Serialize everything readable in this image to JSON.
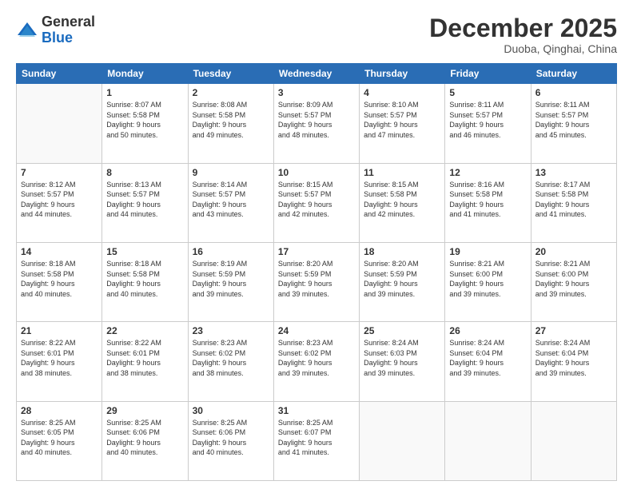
{
  "header": {
    "logo_general": "General",
    "logo_blue": "Blue",
    "month": "December 2025",
    "location": "Duoba, Qinghai, China"
  },
  "weekdays": [
    "Sunday",
    "Monday",
    "Tuesday",
    "Wednesday",
    "Thursday",
    "Friday",
    "Saturday"
  ],
  "weeks": [
    [
      {
        "day": "",
        "info": ""
      },
      {
        "day": "1",
        "info": "Sunrise: 8:07 AM\nSunset: 5:58 PM\nDaylight: 9 hours\nand 50 minutes."
      },
      {
        "day": "2",
        "info": "Sunrise: 8:08 AM\nSunset: 5:58 PM\nDaylight: 9 hours\nand 49 minutes."
      },
      {
        "day": "3",
        "info": "Sunrise: 8:09 AM\nSunset: 5:57 PM\nDaylight: 9 hours\nand 48 minutes."
      },
      {
        "day": "4",
        "info": "Sunrise: 8:10 AM\nSunset: 5:57 PM\nDaylight: 9 hours\nand 47 minutes."
      },
      {
        "day": "5",
        "info": "Sunrise: 8:11 AM\nSunset: 5:57 PM\nDaylight: 9 hours\nand 46 minutes."
      },
      {
        "day": "6",
        "info": "Sunrise: 8:11 AM\nSunset: 5:57 PM\nDaylight: 9 hours\nand 45 minutes."
      }
    ],
    [
      {
        "day": "7",
        "info": "Sunrise: 8:12 AM\nSunset: 5:57 PM\nDaylight: 9 hours\nand 44 minutes."
      },
      {
        "day": "8",
        "info": "Sunrise: 8:13 AM\nSunset: 5:57 PM\nDaylight: 9 hours\nand 44 minutes."
      },
      {
        "day": "9",
        "info": "Sunrise: 8:14 AM\nSunset: 5:57 PM\nDaylight: 9 hours\nand 43 minutes."
      },
      {
        "day": "10",
        "info": "Sunrise: 8:15 AM\nSunset: 5:57 PM\nDaylight: 9 hours\nand 42 minutes."
      },
      {
        "day": "11",
        "info": "Sunrise: 8:15 AM\nSunset: 5:58 PM\nDaylight: 9 hours\nand 42 minutes."
      },
      {
        "day": "12",
        "info": "Sunrise: 8:16 AM\nSunset: 5:58 PM\nDaylight: 9 hours\nand 41 minutes."
      },
      {
        "day": "13",
        "info": "Sunrise: 8:17 AM\nSunset: 5:58 PM\nDaylight: 9 hours\nand 41 minutes."
      }
    ],
    [
      {
        "day": "14",
        "info": "Sunrise: 8:18 AM\nSunset: 5:58 PM\nDaylight: 9 hours\nand 40 minutes."
      },
      {
        "day": "15",
        "info": "Sunrise: 8:18 AM\nSunset: 5:58 PM\nDaylight: 9 hours\nand 40 minutes."
      },
      {
        "day": "16",
        "info": "Sunrise: 8:19 AM\nSunset: 5:59 PM\nDaylight: 9 hours\nand 39 minutes."
      },
      {
        "day": "17",
        "info": "Sunrise: 8:20 AM\nSunset: 5:59 PM\nDaylight: 9 hours\nand 39 minutes."
      },
      {
        "day": "18",
        "info": "Sunrise: 8:20 AM\nSunset: 5:59 PM\nDaylight: 9 hours\nand 39 minutes."
      },
      {
        "day": "19",
        "info": "Sunrise: 8:21 AM\nSunset: 6:00 PM\nDaylight: 9 hours\nand 39 minutes."
      },
      {
        "day": "20",
        "info": "Sunrise: 8:21 AM\nSunset: 6:00 PM\nDaylight: 9 hours\nand 39 minutes."
      }
    ],
    [
      {
        "day": "21",
        "info": "Sunrise: 8:22 AM\nSunset: 6:01 PM\nDaylight: 9 hours\nand 38 minutes."
      },
      {
        "day": "22",
        "info": "Sunrise: 8:22 AM\nSunset: 6:01 PM\nDaylight: 9 hours\nand 38 minutes."
      },
      {
        "day": "23",
        "info": "Sunrise: 8:23 AM\nSunset: 6:02 PM\nDaylight: 9 hours\nand 38 minutes."
      },
      {
        "day": "24",
        "info": "Sunrise: 8:23 AM\nSunset: 6:02 PM\nDaylight: 9 hours\nand 39 minutes."
      },
      {
        "day": "25",
        "info": "Sunrise: 8:24 AM\nSunset: 6:03 PM\nDaylight: 9 hours\nand 39 minutes."
      },
      {
        "day": "26",
        "info": "Sunrise: 8:24 AM\nSunset: 6:04 PM\nDaylight: 9 hours\nand 39 minutes."
      },
      {
        "day": "27",
        "info": "Sunrise: 8:24 AM\nSunset: 6:04 PM\nDaylight: 9 hours\nand 39 minutes."
      }
    ],
    [
      {
        "day": "28",
        "info": "Sunrise: 8:25 AM\nSunset: 6:05 PM\nDaylight: 9 hours\nand 40 minutes."
      },
      {
        "day": "29",
        "info": "Sunrise: 8:25 AM\nSunset: 6:06 PM\nDaylight: 9 hours\nand 40 minutes."
      },
      {
        "day": "30",
        "info": "Sunrise: 8:25 AM\nSunset: 6:06 PM\nDaylight: 9 hours\nand 40 minutes."
      },
      {
        "day": "31",
        "info": "Sunrise: 8:25 AM\nSunset: 6:07 PM\nDaylight: 9 hours\nand 41 minutes."
      },
      {
        "day": "",
        "info": ""
      },
      {
        "day": "",
        "info": ""
      },
      {
        "day": "",
        "info": ""
      }
    ]
  ]
}
